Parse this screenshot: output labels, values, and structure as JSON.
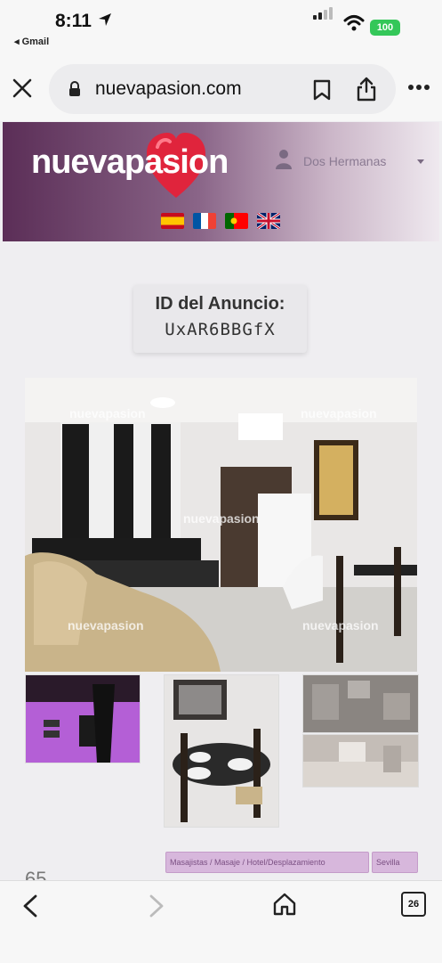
{
  "status_bar": {
    "time": "8:11",
    "back_app": "◂ Gmail",
    "battery": "100",
    "battery_color": "#34c759"
  },
  "browser": {
    "url": "nuevapasion.com",
    "icons": [
      "close-icon",
      "lock-icon",
      "bookmark-icon",
      "share-icon",
      "more-icon"
    ]
  },
  "site": {
    "logo_text": "nuevapasion",
    "user_name": "Dos Hermanas",
    "languages": [
      "es",
      "fr",
      "pt",
      "en"
    ],
    "colors": {
      "header_start": "#5b2e57",
      "header_end": "#efe9ef",
      "tag_bg": "#d7b7dc"
    }
  },
  "listing": {
    "id_label": "ID del Anuncio:",
    "id_value": "UxAR6BBGfX",
    "watermark": "nuevapasion",
    "tags": [
      "Masajistas / Masaje / Hotel/Desplazamiento",
      "Sevilla"
    ],
    "price_peek": "65"
  },
  "toolbar": {
    "tab_count": "26",
    "icons": [
      "back-icon",
      "forward-icon",
      "home-icon",
      "tabs-icon"
    ]
  }
}
